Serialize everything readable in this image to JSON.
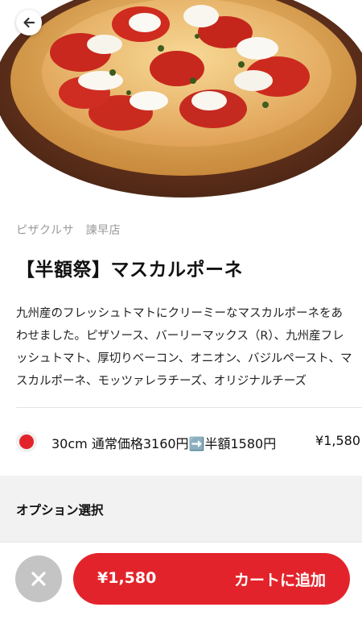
{
  "store": {
    "name": "ピザクルサ　諫早店"
  },
  "product": {
    "title": "【半額祭】マスカルポーネ",
    "description": "九州産のフレッシュトマトにクリーミーなマスカルポーネをあわせました。ピザソース、バーリーマックス（R）、九州産フレッシュトマト、厚切りベーコン、オニオン、バジルペースト、マスカルポーネ、モッツァレラチーズ、オリジナルチーズ",
    "image": "pizza-photo"
  },
  "sizes": [
    {
      "label": "30cm 通常価格3160円➡️半額1580円",
      "price": "¥1,580",
      "selected": true
    }
  ],
  "options": {
    "title": "オプション選択"
  },
  "footer": {
    "close_icon": "close-icon",
    "cart_price": "¥1,580",
    "cart_label": "カートに追加"
  },
  "colors": {
    "accent": "#e3232b",
    "close_button": "#c4c4c4",
    "options_band": "#f2f2f2"
  }
}
